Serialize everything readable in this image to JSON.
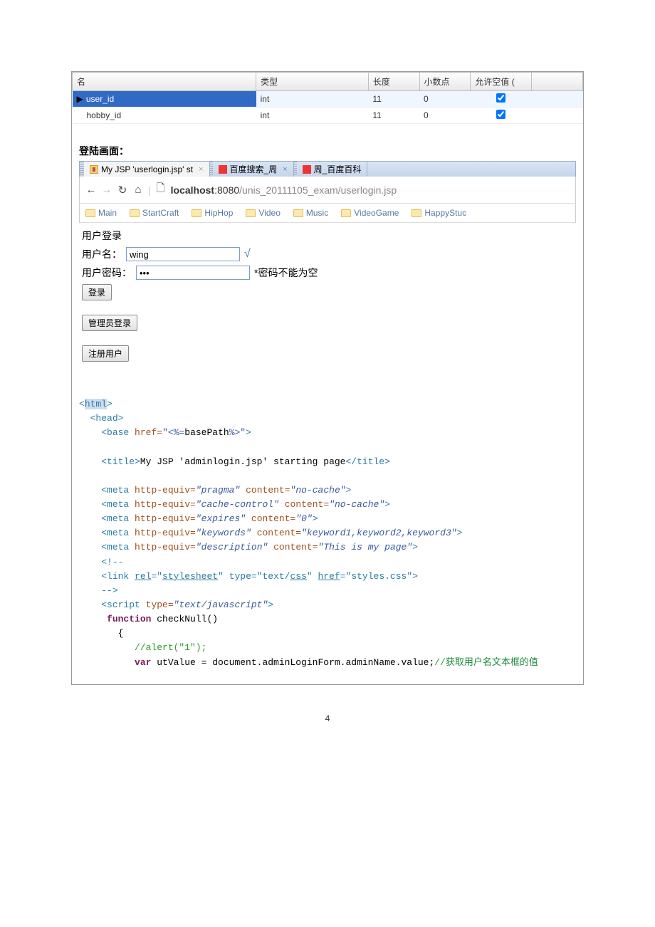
{
  "db_table": {
    "headers": [
      "名",
      "类型",
      "长度",
      "小数点",
      "允许空值 ("
    ],
    "rows": [
      {
        "name": "user_id",
        "type": "int",
        "length": "11",
        "decimal": "0",
        "nullable": true,
        "selected": true
      },
      {
        "name": "hobby_id",
        "type": "int",
        "length": "11",
        "decimal": "0",
        "nullable": true,
        "selected": false
      }
    ]
  },
  "section_heading": "登陆画面：",
  "browser": {
    "tabs": [
      {
        "label": "My JSP 'userlogin.jsp' st",
        "active": true,
        "icon": "jsp",
        "closable": true
      },
      {
        "label": "百度搜索_周",
        "active": false,
        "icon": "baidu",
        "closable": true
      },
      {
        "label": "周_百度百科",
        "active": false,
        "icon": "baidu",
        "closable": false
      }
    ],
    "url_host": "localhost",
    "url_port": ":8080",
    "url_path": "/unis_20111105_exam/userlogin.jsp",
    "bookmarks": [
      "Main",
      "StartCraft",
      "HipHop",
      "Video",
      "Music",
      "VideoGame",
      "HappyStuc"
    ]
  },
  "login": {
    "title": "用户登录",
    "username_label": "用户名：",
    "username_value": "wing",
    "password_label": "用户密码：",
    "password_value": "•••",
    "password_hint": "*密码不能为空",
    "login_btn": "登录",
    "admin_btn": "管理员登录",
    "register_btn": "注册用户"
  },
  "code": {
    "title_text": "My JSP 'adminlogin.jsp' starting page",
    "comment_cn": "获取用户名文本框的值"
  },
  "page_number": "4"
}
